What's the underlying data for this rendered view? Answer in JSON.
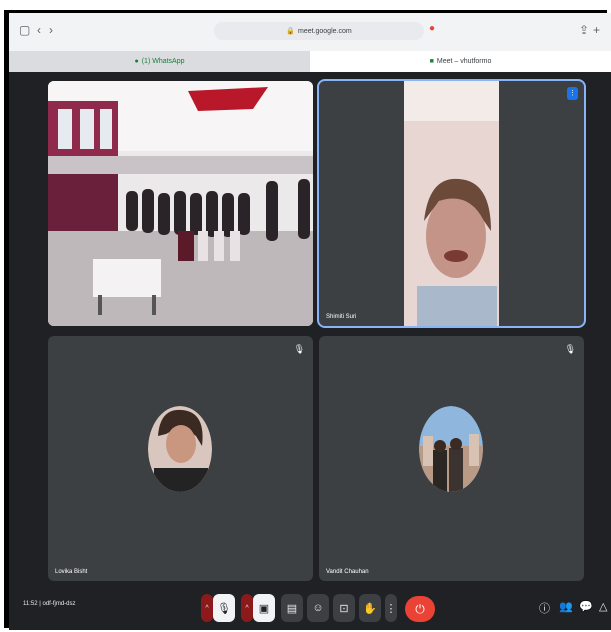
{
  "browser": {
    "url": "meet.google.com",
    "tabs": [
      {
        "label": "(1) WhatsApp"
      },
      {
        "label": "Meet – vhutformo"
      }
    ]
  },
  "participants": [
    {
      "name": ""
    },
    {
      "name": "Shimiti Suri"
    },
    {
      "name": "Lovika Bisht"
    },
    {
      "name": "Vandit Chauhan"
    }
  ],
  "controls": {
    "time": "11:52",
    "meeting_code": "odf-fjmd-dsz",
    "hangup_label": "⏻"
  },
  "colors": {
    "accent": "#8ab4f8",
    "hangup": "#ea4335",
    "background": "#202124",
    "tile": "#3c4043"
  }
}
